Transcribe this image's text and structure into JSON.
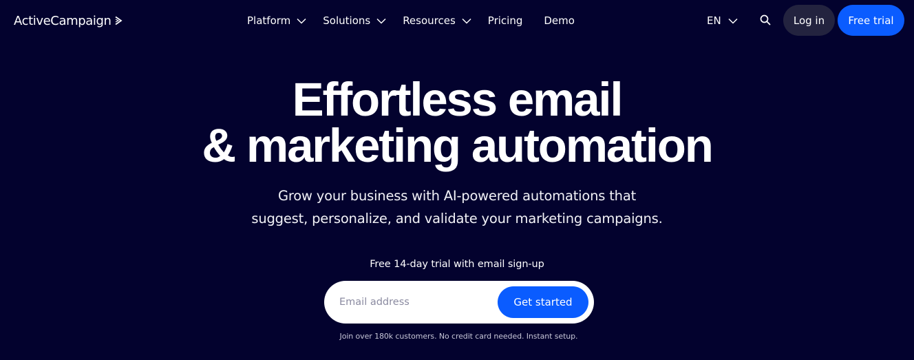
{
  "header": {
    "logo_text": "ActiveCampaign",
    "nav": [
      {
        "label": "Platform",
        "has_dropdown": true
      },
      {
        "label": "Solutions",
        "has_dropdown": true
      },
      {
        "label": "Resources",
        "has_dropdown": true
      },
      {
        "label": "Pricing",
        "has_dropdown": false
      },
      {
        "label": "Demo",
        "has_dropdown": false
      }
    ],
    "language": "EN",
    "search_icon": "search-icon",
    "login_label": "Log in",
    "free_trial_label": "Free trial"
  },
  "hero": {
    "headline_line1": "Effortless email",
    "headline_line2": "& marketing automation",
    "subtitle_line1": "Grow your business with AI-powered automations that",
    "subtitle_line2": "suggest, personalize, and validate your marketing campaigns.",
    "trial_label": "Free 14-day trial with email sign-up",
    "email_placeholder": "Email address",
    "email_value": "",
    "cta_label": "Get started",
    "fine_print": "Join over 180k customers. No credit card needed. Instant setup."
  },
  "colors": {
    "background": "#03022e",
    "primary_blue": "#0a5cff",
    "login_bg": "#23233f",
    "text": "#ffffff"
  }
}
